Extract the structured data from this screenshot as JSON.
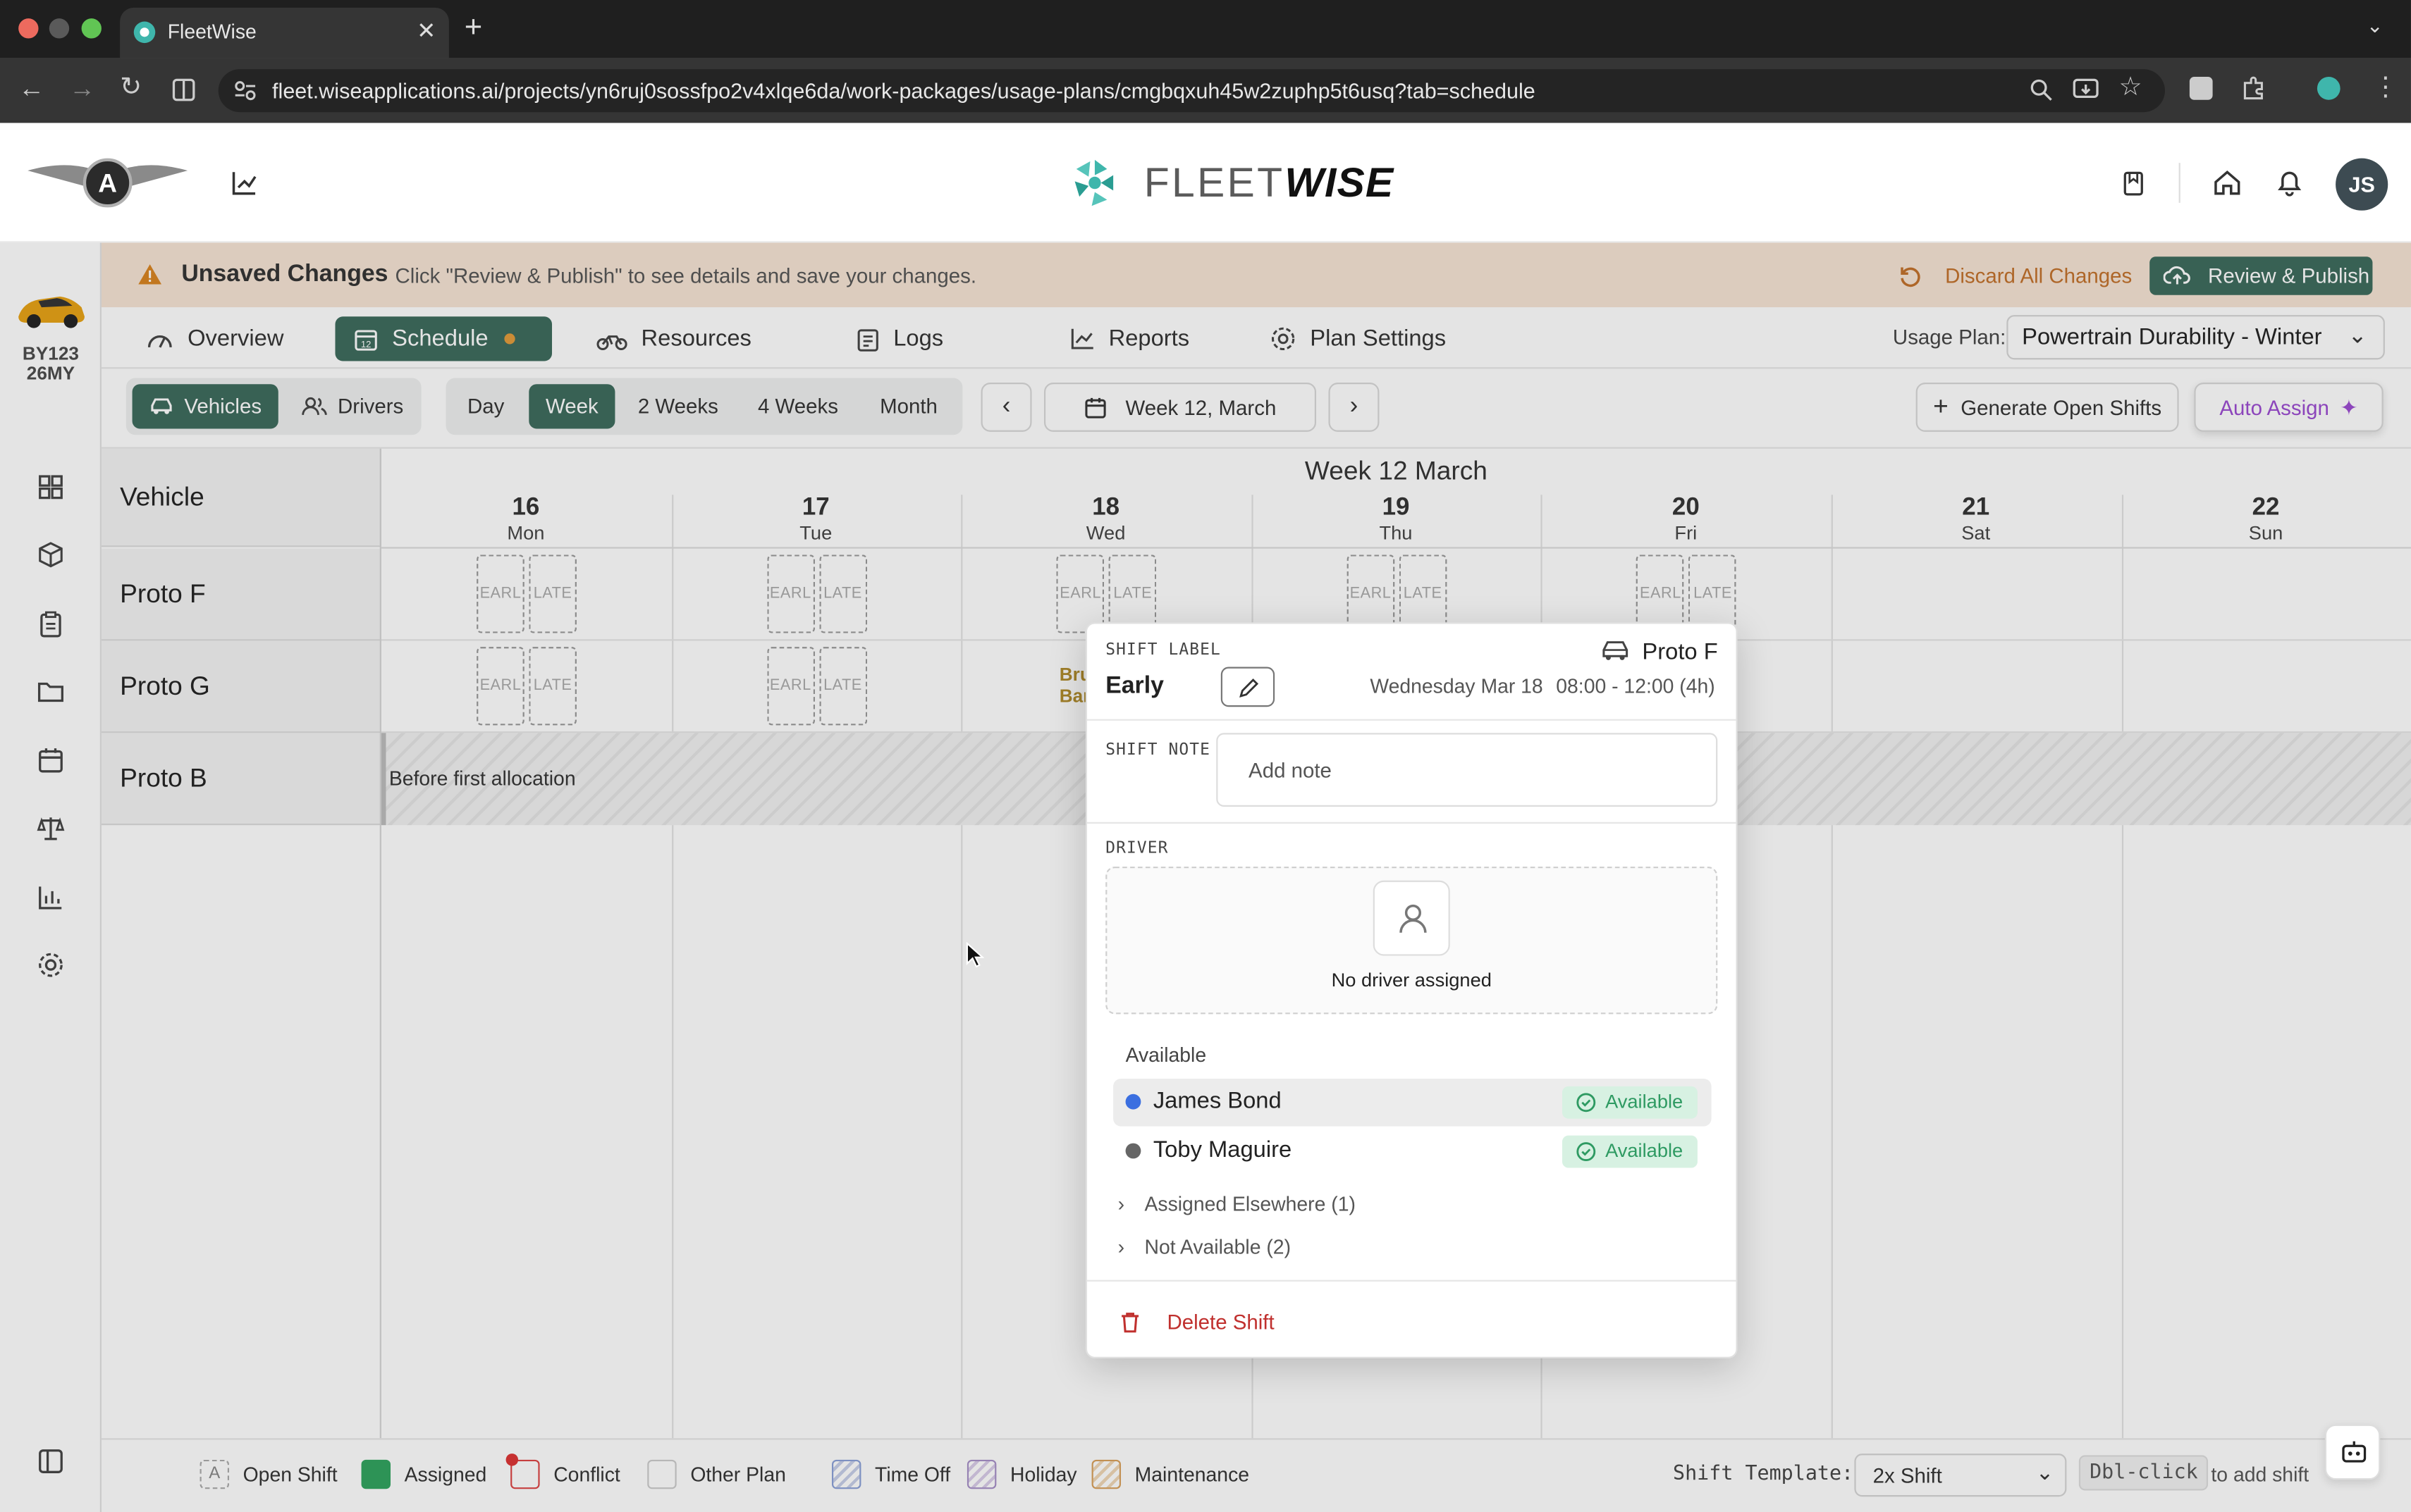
{
  "browser": {
    "tab_title": "FleetWise",
    "url": "fleet.wiseapplications.ai/projects/yn6ruj0sossfpo2v4xlqe6da/work-packages/usage-plans/cmgbqxuh45w2zuphp5t6usq?tab=schedule"
  },
  "header": {
    "brand_light": "FLEET",
    "brand_bold": "WISE",
    "avatar": "JS"
  },
  "vehicle_id": [
    "BY123",
    "26MY"
  ],
  "banner": {
    "title": "Unsaved Changes",
    "message": "Click \"Review & Publish\" to see details and save your changes.",
    "discard": "Discard All Changes",
    "publish": "Review & Publish"
  },
  "tabs": [
    "Overview",
    "Schedule",
    "Resources",
    "Logs",
    "Reports",
    "Plan Settings"
  ],
  "usage_plan": {
    "label": "Usage Plan:",
    "value": "Powertrain Durability - Winter"
  },
  "controls": {
    "mode": [
      "Vehicles",
      "Drivers"
    ],
    "ranges": [
      "Day",
      "Week",
      "2 Weeks",
      "4 Weeks",
      "Month"
    ],
    "week_label": "Week 12, March",
    "generate": "Generate Open Shifts",
    "auto_assign": "Auto Assign"
  },
  "grid": {
    "title": "Week 12 March",
    "corner": "Vehicle",
    "days": [
      {
        "num": "16",
        "name": "Mon"
      },
      {
        "num": "17",
        "name": "Tue"
      },
      {
        "num": "18",
        "name": "Wed"
      },
      {
        "num": "19",
        "name": "Thu"
      },
      {
        "num": "20",
        "name": "Fri"
      },
      {
        "num": "21",
        "name": "Sat"
      },
      {
        "num": "22",
        "name": "Sun"
      }
    ],
    "rows": [
      "Proto F",
      "Proto G",
      "Proto B"
    ],
    "slot_early": "EARL",
    "slot_late": "LATE",
    "before_first": "Before first allocation",
    "peek_1": "Bru",
    "peek_2": "Bar"
  },
  "popover": {
    "shift_label_title": "SHIFT LABEL",
    "shift_label": "Early",
    "vehicle": "Proto F",
    "date": "Wednesday Mar 18",
    "time": "08:00 - 12:00 (4h)",
    "note_title": "SHIFT NOTE",
    "note_placeholder": "Add note",
    "driver_title": "DRIVER",
    "no_driver": "No driver assigned",
    "available_title": "Available",
    "drivers": [
      {
        "name": "James Bond",
        "status": "Available",
        "dot": "#3b6fe0"
      },
      {
        "name": "Toby Maguire",
        "status": "Available",
        "dot": "#666666"
      }
    ],
    "assigned_elsewhere": "Assigned Elsewhere (1)",
    "not_available": "Not Available (2)",
    "delete": "Delete Shift"
  },
  "legend": {
    "items": [
      "Open Shift",
      "Assigned",
      "Conflict",
      "Other Plan",
      "Time Off",
      "Holiday",
      "Maintenance"
    ],
    "open_letter": "A",
    "template_label": "Shift Template:",
    "template_value": "2x Shift",
    "dbl": "Dbl-click",
    "dbl_hint": "to add shift"
  },
  "colors": {
    "accent": "#3c6a5c",
    "warning": "#c2702a",
    "danger": "#c0302e",
    "available": "#2e9a62"
  }
}
